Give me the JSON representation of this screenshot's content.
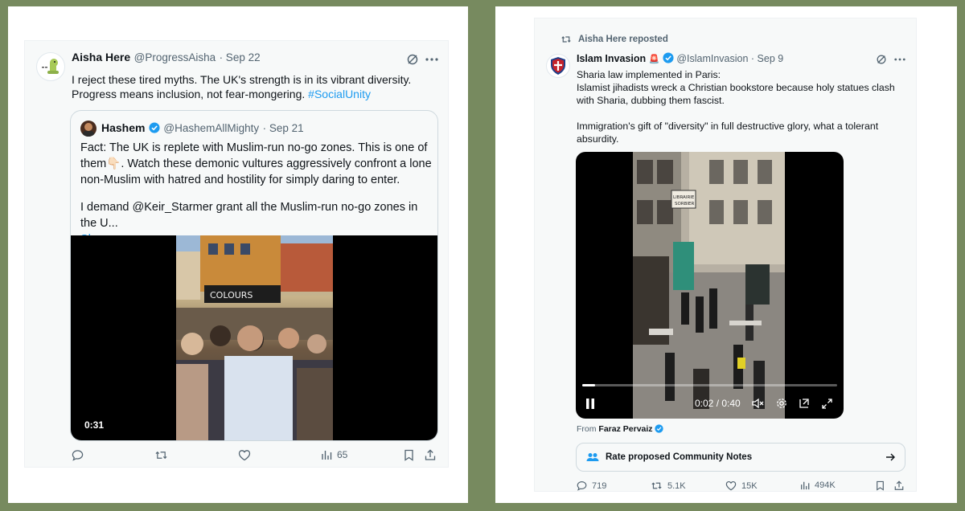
{
  "left_tweet": {
    "author_name": "Aisha Here",
    "author_handle": "@ProgressAisha",
    "date": "· Sep 22",
    "text_line1": "I reject these tired myths. The UK's strength is in its vibrant diversity.",
    "text_line2_main": "Progress means inclusion, not fear-mongering. ",
    "hashtag": "#SocialUnity",
    "quoted": {
      "author_name": "Hashem",
      "author_handle": "@HashemAllMighty",
      "date": "· Sep 21",
      "line1": "Fact: The UK is replete with Muslim-run no-go zones. This is one of",
      "line2a": "them",
      "line2_emoji": "👇🏻",
      "line2b": ". Watch these demonic vultures aggressively confront a lone",
      "line3": "non-Muslim with hatred and hostility for simply daring to enter.",
      "line4": "I demand @Keir_Starmer grant all the Muslim-run no-go zones in the U...",
      "show_more": "Show more",
      "video_time": "0:31",
      "storefront_sign": "COLOURS"
    },
    "actions": {
      "views": "65"
    }
  },
  "right_tweet": {
    "repost_label": "Aisha Here reposted",
    "author_name": "Islam Invasion",
    "siren_emoji": "🚨",
    "author_handle": "@IslamInvasion",
    "date": "· Sep 9",
    "line1": "Sharia law implemented in Paris:",
    "line2": "Islamist jihadists wreck a Christian bookstore because holy statues clash",
    "line3": "with Sharia, dubbing them fascist.",
    "line4": "Immigration's gift of \"diversity\" in full destructive glory, what a tolerant",
    "line5": "absurdity.",
    "video_time": "0:02 / 0:40",
    "video_progress": 0.05,
    "shop_sign_line1": "LIBRAIRIE",
    "shop_sign_line2": "SORBIER",
    "from_label": "From ",
    "from_name": "Faraz Pervaiz",
    "community_notes_label": "Rate proposed Community Notes",
    "actions": {
      "replies": "719",
      "reposts": "5.1K",
      "likes": "15K",
      "views": "494K"
    }
  },
  "colors": {
    "background": "#778a5f",
    "accent": "#1d9bf0",
    "verified": "#1d9bf0",
    "text_secondary": "#536471"
  }
}
